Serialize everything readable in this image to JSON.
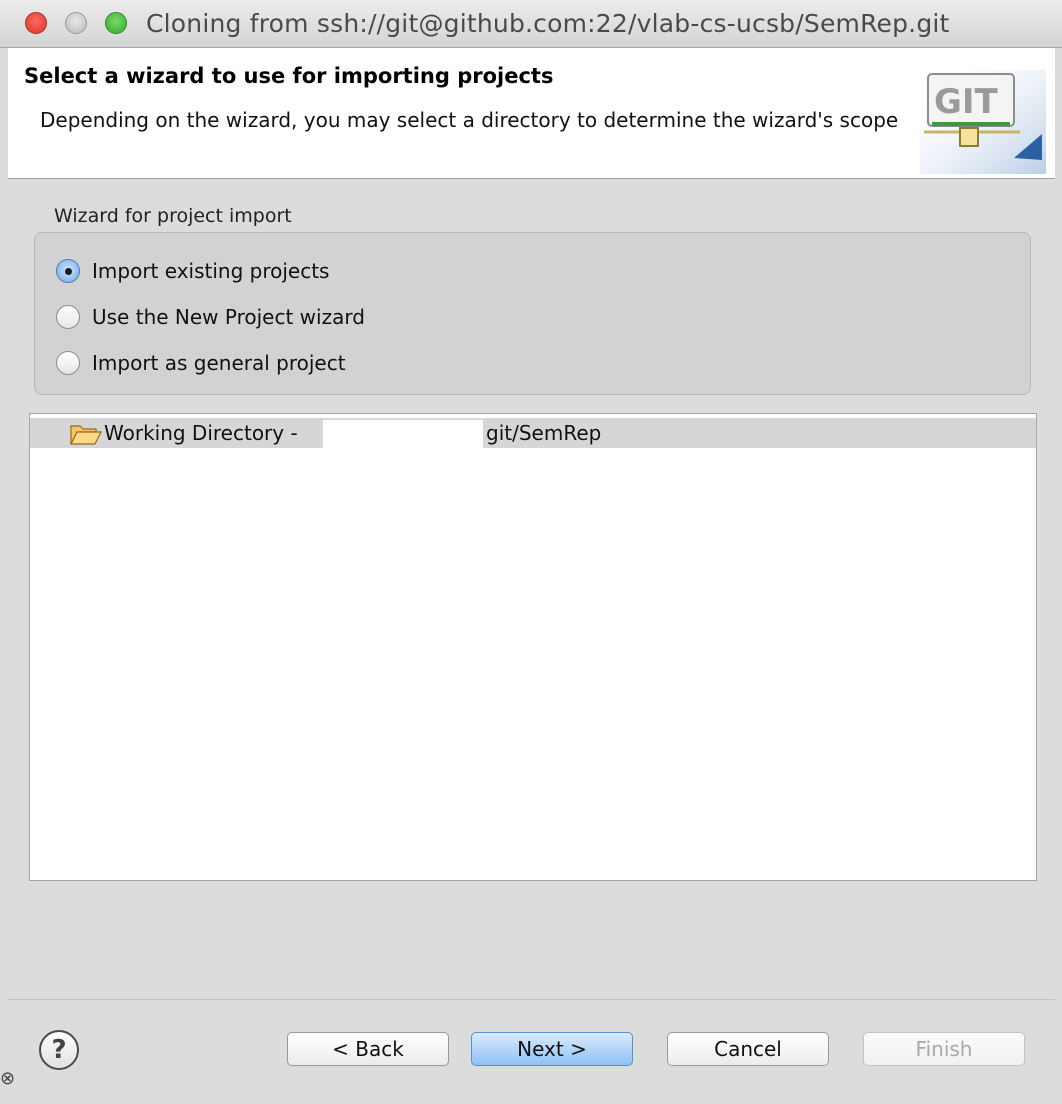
{
  "window": {
    "title": "Cloning from ssh://git@github.com:22/vlab-cs-ucsb/SemRep.git"
  },
  "header": {
    "title": "Select a wizard to use for importing projects",
    "description": "Depending on the wizard, you may select a directory to determine the wizard's scope",
    "logo_icon": "git-logo-icon",
    "logo_text": "GIT"
  },
  "wizard_group": {
    "label": "Wizard for project import",
    "options": [
      {
        "label": "Import existing projects",
        "selected": true
      },
      {
        "label": "Use the New Project wizard",
        "selected": false
      },
      {
        "label": "Import as general project",
        "selected": false
      }
    ]
  },
  "tree": {
    "items": [
      {
        "icon": "folder-open-icon",
        "label_prefix": "Working Directory - ",
        "label_suffix": "git/SemRep"
      }
    ]
  },
  "footer": {
    "help_icon": "help-icon",
    "help_symbol": "?",
    "buttons": {
      "back": "< Back",
      "next": "Next >",
      "cancel": "Cancel",
      "finish": "Finish"
    }
  },
  "colors": {
    "default_button": "#8fc0f2",
    "selection_row": "#d6d6d6",
    "dialog_bg": "#dcdcdc"
  }
}
